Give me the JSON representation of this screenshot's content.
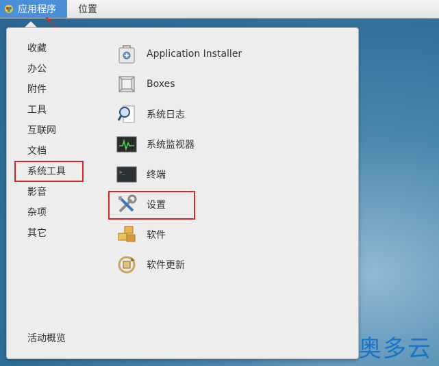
{
  "topbar": {
    "applications_label": "应用程序",
    "places_label": "位置"
  },
  "categories": [
    {
      "label": "收藏"
    },
    {
      "label": "办公"
    },
    {
      "label": "附件"
    },
    {
      "label": "工具"
    },
    {
      "label": "互联网"
    },
    {
      "label": "文档"
    },
    {
      "label": "系统工具"
    },
    {
      "label": "影音"
    },
    {
      "label": "杂项"
    },
    {
      "label": "其它"
    }
  ],
  "apps": [
    {
      "label": "Application Installer",
      "icon": "app-installer-icon"
    },
    {
      "label": "Boxes",
      "icon": "boxes-icon"
    },
    {
      "label": "系统日志",
      "icon": "system-log-icon"
    },
    {
      "label": "系统监视器",
      "icon": "system-monitor-icon"
    },
    {
      "label": "终端",
      "icon": "terminal-icon"
    },
    {
      "label": "设置",
      "icon": "settings-icon"
    },
    {
      "label": "软件",
      "icon": "software-icon"
    },
    {
      "label": "软件更新",
      "icon": "software-update-icon"
    }
  ],
  "overview_label": "活动概览",
  "watermark": "奥多云",
  "colors": {
    "highlight_box": "#d92626",
    "applications_bg": "#4a90d9",
    "menu_bg": "#ededed"
  }
}
